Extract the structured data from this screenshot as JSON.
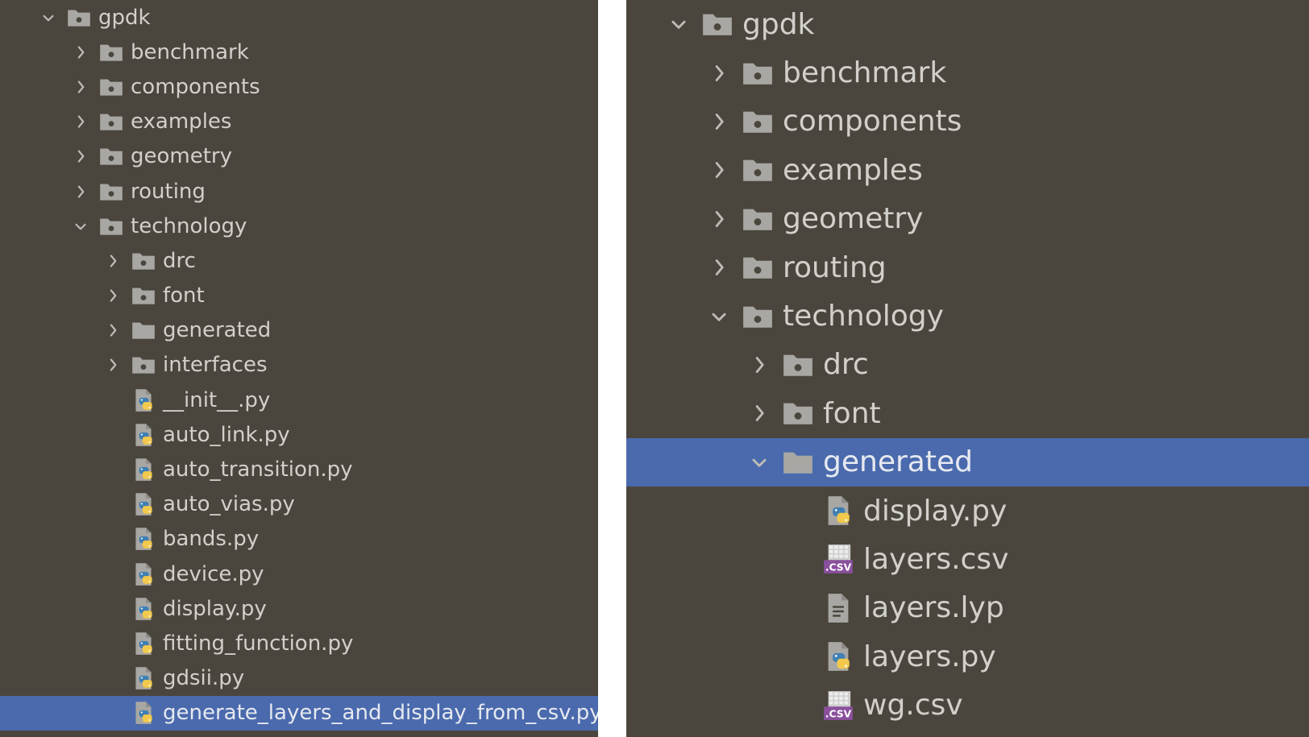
{
  "left_tree": [
    {
      "label": "gpdk",
      "type": "folder",
      "icon": "folder-icon",
      "expanded": true,
      "depth": 0,
      "selected": false
    },
    {
      "label": "benchmark",
      "type": "folder",
      "icon": "folder-icon",
      "expanded": false,
      "depth": 1,
      "selected": false
    },
    {
      "label": "components",
      "type": "folder",
      "icon": "folder-icon",
      "expanded": false,
      "depth": 1,
      "selected": false
    },
    {
      "label": "examples",
      "type": "folder",
      "icon": "folder-icon",
      "expanded": false,
      "depth": 1,
      "selected": false
    },
    {
      "label": "geometry",
      "type": "folder",
      "icon": "folder-icon",
      "expanded": false,
      "depth": 1,
      "selected": false
    },
    {
      "label": "routing",
      "type": "folder",
      "icon": "folder-icon",
      "expanded": false,
      "depth": 1,
      "selected": false
    },
    {
      "label": "technology",
      "type": "folder",
      "icon": "folder-icon",
      "expanded": true,
      "depth": 1,
      "selected": false
    },
    {
      "label": "drc",
      "type": "folder",
      "icon": "folder-icon",
      "expanded": false,
      "depth": 2,
      "selected": false
    },
    {
      "label": "font",
      "type": "folder",
      "icon": "folder-icon",
      "expanded": false,
      "depth": 2,
      "selected": false
    },
    {
      "label": "generated",
      "type": "folder-plain",
      "icon": "plain-folder-icon",
      "expanded": false,
      "depth": 2,
      "selected": false
    },
    {
      "label": "interfaces",
      "type": "folder",
      "icon": "folder-icon",
      "expanded": false,
      "depth": 2,
      "selected": false
    },
    {
      "label": "__init__.py",
      "type": "py",
      "icon": "python-file-icon",
      "depth": 2,
      "selected": false
    },
    {
      "label": "auto_link.py",
      "type": "py",
      "icon": "python-file-icon",
      "depth": 2,
      "selected": false
    },
    {
      "label": "auto_transition.py",
      "type": "py",
      "icon": "python-file-icon",
      "depth": 2,
      "selected": false
    },
    {
      "label": "auto_vias.py",
      "type": "py",
      "icon": "python-file-icon",
      "depth": 2,
      "selected": false
    },
    {
      "label": "bands.py",
      "type": "py",
      "icon": "python-file-icon",
      "depth": 2,
      "selected": false
    },
    {
      "label": "device.py",
      "type": "py",
      "icon": "python-file-icon",
      "depth": 2,
      "selected": false
    },
    {
      "label": "display.py",
      "type": "py",
      "icon": "python-file-icon",
      "depth": 2,
      "selected": false
    },
    {
      "label": "fitting_function.py",
      "type": "py",
      "icon": "python-file-icon",
      "depth": 2,
      "selected": false
    },
    {
      "label": "gdsii.py",
      "type": "py",
      "icon": "python-file-icon",
      "depth": 2,
      "selected": false
    },
    {
      "label": "generate_layers_and_display_from_csv.py",
      "type": "py",
      "icon": "python-file-icon",
      "depth": 2,
      "selected": true
    }
  ],
  "right_tree": [
    {
      "label": "gpdk",
      "type": "folder",
      "icon": "folder-icon",
      "expanded": true,
      "depth": 0,
      "selected": false
    },
    {
      "label": "benchmark",
      "type": "folder",
      "icon": "folder-icon",
      "expanded": false,
      "depth": 1,
      "selected": false
    },
    {
      "label": "components",
      "type": "folder",
      "icon": "folder-icon",
      "expanded": false,
      "depth": 1,
      "selected": false
    },
    {
      "label": "examples",
      "type": "folder",
      "icon": "folder-icon",
      "expanded": false,
      "depth": 1,
      "selected": false
    },
    {
      "label": "geometry",
      "type": "folder",
      "icon": "folder-icon",
      "expanded": false,
      "depth": 1,
      "selected": false
    },
    {
      "label": "routing",
      "type": "folder",
      "icon": "folder-icon",
      "expanded": false,
      "depth": 1,
      "selected": false
    },
    {
      "label": "technology",
      "type": "folder",
      "icon": "folder-icon",
      "expanded": true,
      "depth": 1,
      "selected": false
    },
    {
      "label": "drc",
      "type": "folder",
      "icon": "folder-icon",
      "expanded": false,
      "depth": 2,
      "selected": false
    },
    {
      "label": "font",
      "type": "folder",
      "icon": "folder-icon",
      "expanded": false,
      "depth": 2,
      "selected": false
    },
    {
      "label": "generated",
      "type": "folder-plain",
      "icon": "plain-folder-icon",
      "expanded": true,
      "depth": 2,
      "selected": true
    },
    {
      "label": "display.py",
      "type": "py",
      "icon": "python-file-icon",
      "depth": 3,
      "selected": false
    },
    {
      "label": "layers.csv",
      "type": "csv",
      "icon": "csv-file-icon",
      "icon_text": ".CSV",
      "depth": 3,
      "selected": false
    },
    {
      "label": "layers.lyp",
      "type": "text",
      "icon": "text-file-icon",
      "depth": 3,
      "selected": false
    },
    {
      "label": "layers.py",
      "type": "py",
      "icon": "python-file-icon",
      "depth": 3,
      "selected": false
    },
    {
      "label": "wg.csv",
      "type": "csv",
      "icon": "csv-file-icon",
      "icon_text": ".CSV",
      "depth": 3,
      "selected": false
    }
  ],
  "colors": {
    "panel_bg": "#4b463d",
    "text": "#d2d0cb",
    "selection": "#4a6aad",
    "folder": "#a8a7a3",
    "arrow": "#bebcb7",
    "python_blue": "#3f7fb3",
    "python_yellow": "#f2c94c",
    "csv_purple": "#8a4f9d"
  }
}
